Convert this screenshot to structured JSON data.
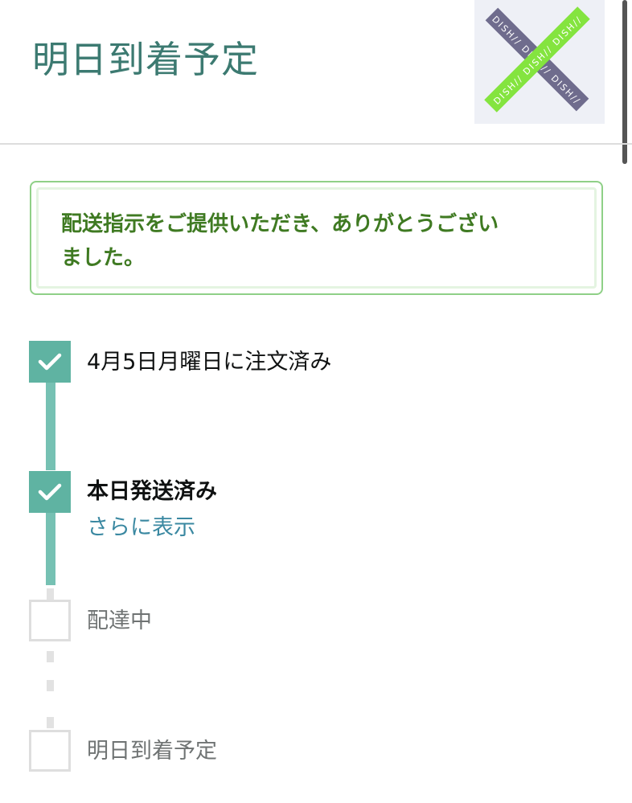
{
  "header": {
    "title": "明日到着予定",
    "thumbnail_text": "DISH// DISH// DISH//",
    "thumbnail_colors": [
      "#6f6c8d",
      "#84e43f",
      "#eef0f6"
    ]
  },
  "alert": {
    "message_line1": "配送指示をご提供いただき、ありがとうござい",
    "message_line2": "ました。",
    "colors": {
      "border": "#8fd087",
      "text": "#3f7a22"
    }
  },
  "tracker": {
    "accent_color": "#5fb3a2",
    "steps": [
      {
        "label": "4月5日月曜日に注文済み",
        "status": "done",
        "icon": "checkmark-icon"
      },
      {
        "label": "本日発送済み",
        "status": "current",
        "icon": "checkmark-icon",
        "link": "さらに表示"
      },
      {
        "label": "配達中",
        "status": "pending",
        "icon": "empty-checkbox-icon"
      },
      {
        "label": "明日到着予定",
        "status": "pending",
        "icon": "empty-checkbox-icon"
      }
    ]
  }
}
